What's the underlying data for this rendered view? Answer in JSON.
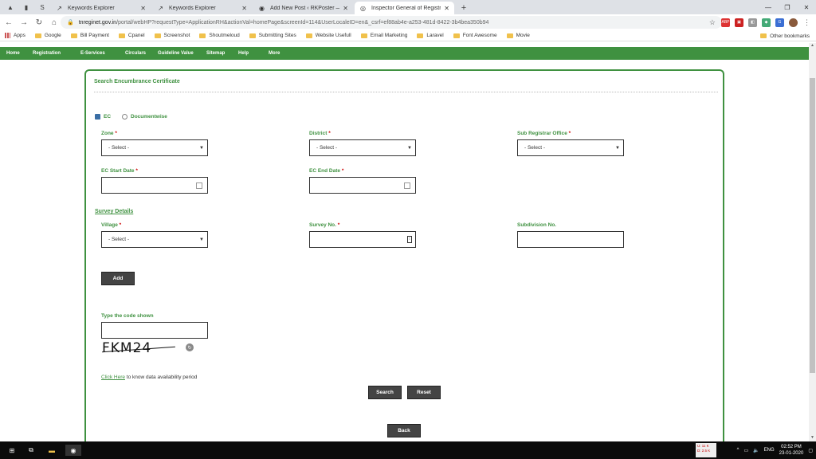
{
  "browser": {
    "tabs": [
      {
        "title": "Keywords Explorer",
        "active": false
      },
      {
        "title": "Keywords Explorer",
        "active": false
      },
      {
        "title": "Add New Post ‹ RKPoster — Wo",
        "active": false
      },
      {
        "title": "Inspector General of Registratio",
        "active": true
      }
    ],
    "url_domain": "tnreginet.gov.in",
    "url_path": "/portal/webHP?requestType=ApplicationRH&actionVal=homePage&screenId=114&UserLocaleID=en&_csrf=ef88ab4e-a253-481d-8422-3b4bea350b94",
    "bookmarks": [
      "Apps",
      "Google",
      "Bill Payment",
      "Cpanel",
      "Screenshot",
      "Shoutmeloud",
      "Submitting Sites",
      "Website Usefull",
      "Email Marketing",
      "Laravel",
      "Font Awesome",
      "Movie"
    ],
    "other_bookmarks": "Other bookmarks"
  },
  "nav": [
    "Home",
    "Registration",
    "E-Services",
    "Circulars",
    "Guideline Value",
    "Sitemap",
    "Help",
    "More"
  ],
  "form": {
    "title": "Search Encumbrance Certificate",
    "radio_ec": "EC",
    "radio_doc": "Documentwise",
    "zone_label": "Zone",
    "district_label": "District",
    "sro_label": "Sub Registrar Office",
    "select_placeholder": "- Select -",
    "start_label": "EC Start Date",
    "end_label": "EC End Date",
    "survey_heading": "Survey Details",
    "village_label": "Village",
    "survey_label": "Survey No.",
    "subdivision_label": "Subdivision No.",
    "add_btn": "Add",
    "captcha_label": "Type the code shown",
    "captcha_code": "FKM24",
    "click_here": "Click Here",
    "availability_text": " to know data availability period",
    "search_btn": "Search",
    "reset_btn": "Reset",
    "back_btn": "Back",
    "required_mark": "*"
  },
  "taskbar": {
    "lang": "ENG",
    "time": "02:52 PM",
    "date": "23-01-2020",
    "net_up": "U: 11 K",
    "net_down": "D: 2.5 K"
  }
}
